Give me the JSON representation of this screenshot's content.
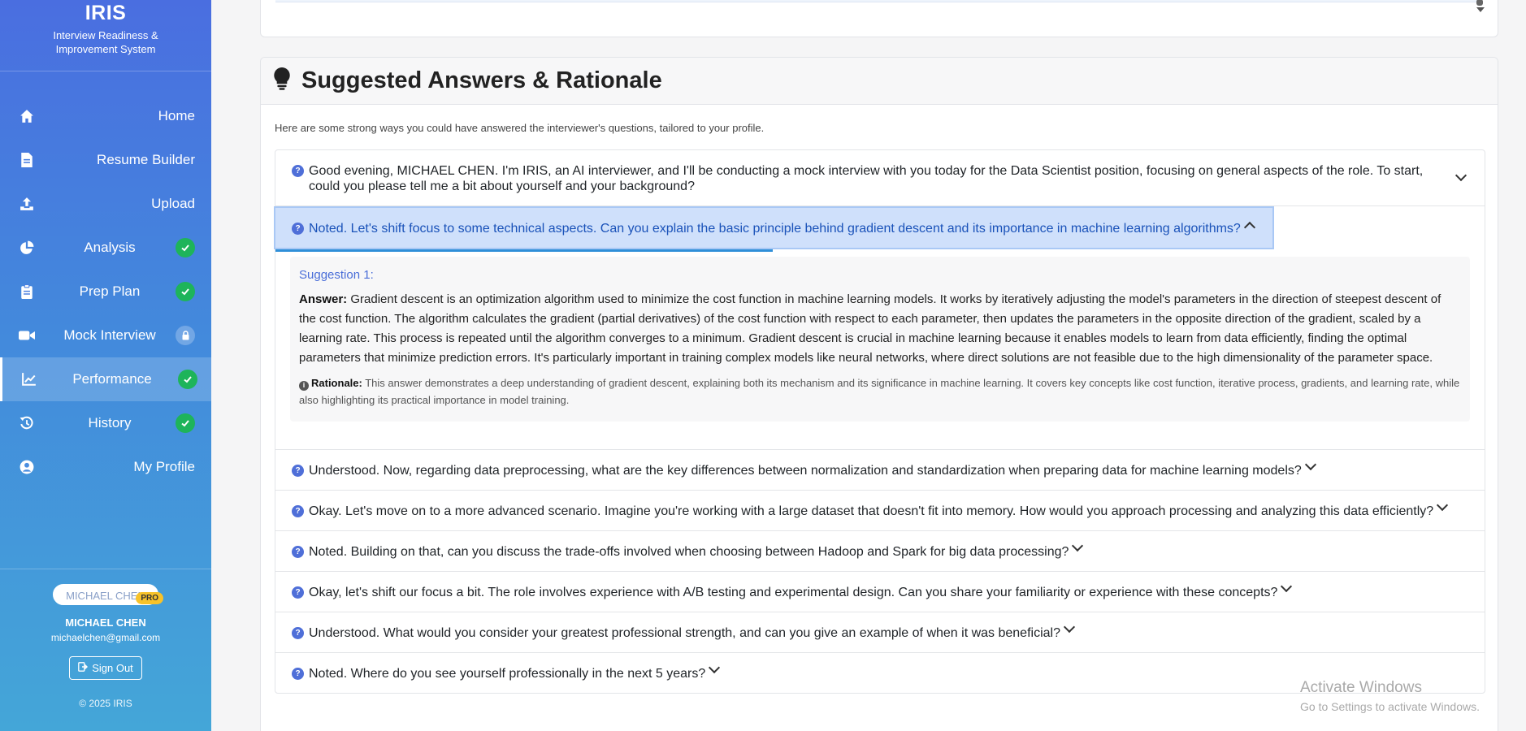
{
  "brand": {
    "title": "IRIS",
    "subtitle": "Interview Readiness & Improvement System"
  },
  "nav": [
    {
      "label": "Home",
      "icon": "home-icon",
      "align": "right"
    },
    {
      "label": "Resume Builder",
      "icon": "document-icon",
      "align": "right"
    },
    {
      "label": "Upload",
      "icon": "upload-icon",
      "align": "right"
    },
    {
      "label": "Analysis",
      "icon": "pie-chart-icon",
      "align": "center",
      "badge": "check"
    },
    {
      "label": "Prep Plan",
      "icon": "clipboard-icon",
      "align": "center",
      "badge": "check"
    },
    {
      "label": "Mock Interview",
      "icon": "video-icon",
      "align": "center",
      "badge": "lock"
    },
    {
      "label": "Performance",
      "icon": "chart-line-icon",
      "align": "center",
      "badge": "check",
      "active": true
    },
    {
      "label": "History",
      "icon": "history-icon",
      "align": "center",
      "badge": "check"
    },
    {
      "label": "My Profile",
      "icon": "user-circle-icon",
      "align": "right"
    }
  ],
  "user": {
    "avatar_alt": "MICHAEL CHEN",
    "plan_badge": "PRO",
    "name": "MICHAEL CHEN",
    "email": "michaelchen@gmail.com",
    "signout_label": "Sign Out",
    "copyright": "© 2025 IRIS"
  },
  "section": {
    "title": "Suggested Answers & Rationale",
    "intro": "Here are some strong ways you could have answered the interviewer's questions, tailored to your profile."
  },
  "questions": [
    "Good evening, MICHAEL CHEN. I'm IRIS, an AI interviewer, and I'll be conducting a mock interview with you today for the Data Scientist position, focusing on general aspects of the role. To start, could you please tell me a bit about yourself and your background?",
    "Noted. Let's shift focus to some technical aspects. Can you explain the basic principle behind gradient descent and its importance in machine learning algorithms?",
    "Understood. Now, regarding data preprocessing, what are the key differences between normalization and standardization when preparing data for machine learning models?",
    "Okay. Let's move on to a more advanced scenario. Imagine you're working with a large dataset that doesn't fit into memory. How would you approach processing and analyzing this data efficiently?",
    "Noted. Building on that, can you discuss the trade-offs involved when choosing between Hadoop and Spark for big data processing?",
    "Okay, let's shift our focus a bit. The role involves experience with A/B testing and experimental design. Can you share your familiarity or experience with these concepts?",
    "Understood. What would you consider your greatest professional strength, and can you give an example of when it was beneficial?",
    "Noted. Where do you see yourself professionally in the next 5 years?"
  ],
  "open_question": {
    "suggestion_title": "Suggestion 1:",
    "answer_label": "Answer:",
    "answer_text": "Gradient descent is an optimization algorithm used to minimize the cost function in machine learning models. It works by iteratively adjusting the model's parameters in the direction of steepest descent of the cost function. The algorithm calculates the gradient (partial derivatives) of the cost function with respect to each parameter, then updates the parameters in the opposite direction of the gradient, scaled by a learning rate. This process is repeated until the algorithm converges to a minimum. Gradient descent is crucial in machine learning because it enables models to learn from data efficiently, finding the optimal parameters that minimize prediction errors. It's particularly important in training complex models like neural networks, where direct solutions are not feasible due to the high dimensionality of the parameter space.",
    "rationale_label": "Rationale:",
    "rationale_text": "This answer demonstrates a deep understanding of gradient descent, explaining both its mechanism and its significance in machine learning. It covers key concepts like cost function, iterative process, gradients, and learning rate, while also highlighting its practical importance in model training."
  },
  "watermark": {
    "line1": "Activate Windows",
    "line2": "Go to Settings to activate Windows."
  },
  "colors": {
    "accent": "#4a6ed8",
    "success": "#1eb45a",
    "pro_badge": "#f7c22a"
  }
}
